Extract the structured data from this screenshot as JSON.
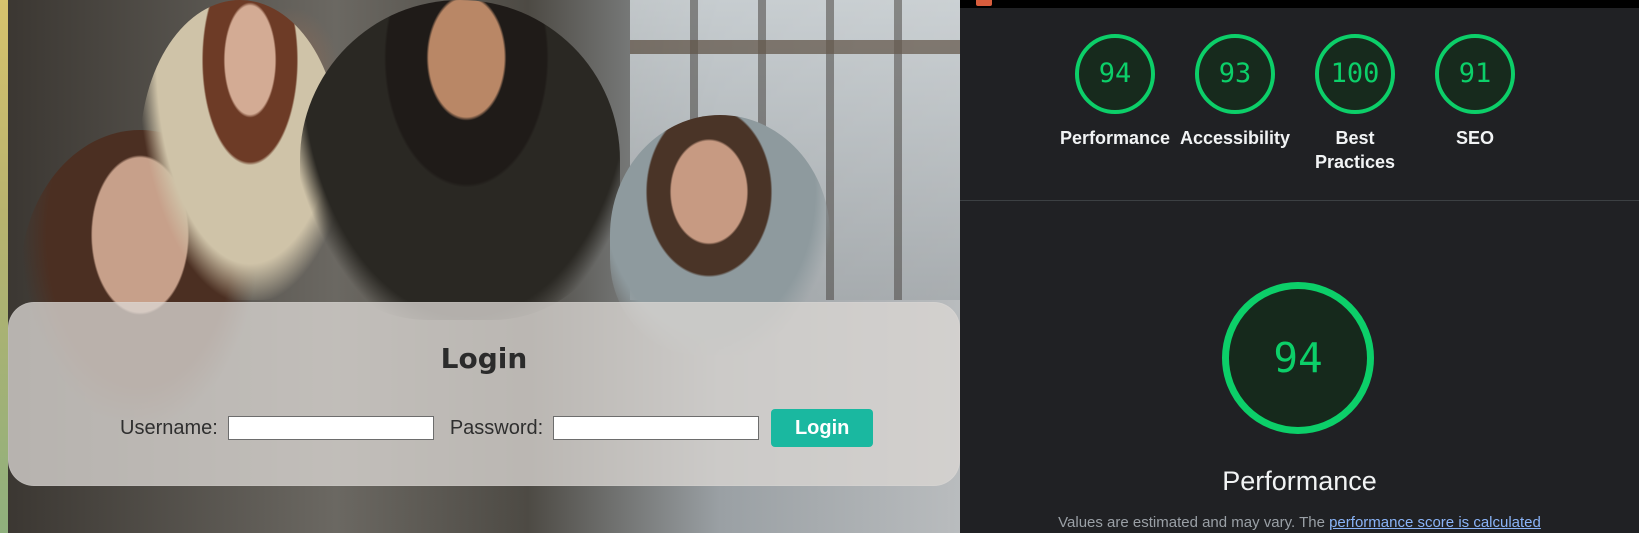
{
  "login": {
    "title": "Login",
    "username_label": "Username:",
    "username_value": "",
    "password_label": "Password:",
    "password_value": "",
    "button_label": "Login"
  },
  "report": {
    "scores": [
      {
        "label": "Performance",
        "value": "94",
        "color": "#0ccf69"
      },
      {
        "label": "Accessibility",
        "value": "93",
        "color": "#0ccf69"
      },
      {
        "label": "Best Practices",
        "value": "100",
        "color": "#0ccf69"
      },
      {
        "label": "SEO",
        "value": "91",
        "color": "#0ccf69"
      }
    ],
    "main_score": "94",
    "main_title": "Performance",
    "note_text": "Values are estimated and may vary. The ",
    "note_link": "performance score is calculated"
  },
  "icons": [
    "lighthouse-tab-icon"
  ]
}
